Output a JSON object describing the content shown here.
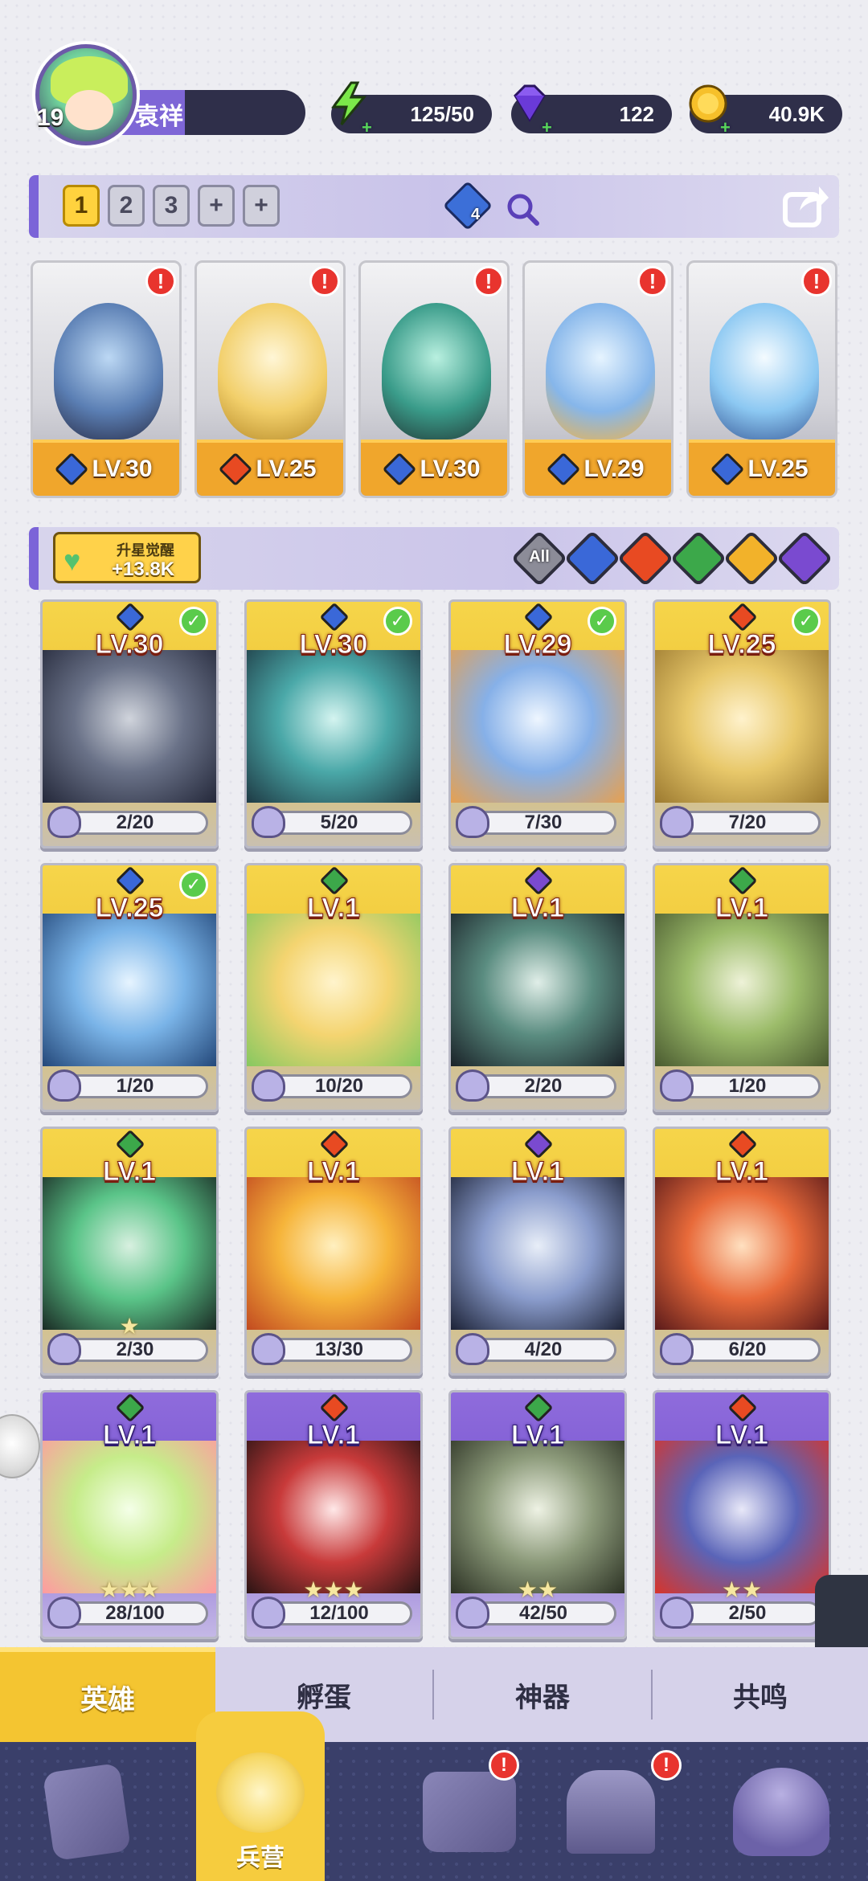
{
  "player": {
    "level": "19",
    "name": "袁祥"
  },
  "resources": {
    "energy": {
      "value": "125/50",
      "icon": "lightning-icon"
    },
    "gems": {
      "value": "122",
      "icon": "gem-icon"
    },
    "gold": {
      "value": "40.9K",
      "icon": "coin-icon"
    }
  },
  "team": {
    "tabs": [
      "1",
      "2",
      "3",
      "+",
      "+"
    ],
    "active_tab": "1",
    "element_count": "4",
    "alert_glyph": "!",
    "lineup": [
      {
        "level": "LV.30",
        "element": "water",
        "color": "#3a68d8"
      },
      {
        "level": "LV.25",
        "element": "fire",
        "color": "#e84a22"
      },
      {
        "level": "LV.30",
        "element": "water",
        "color": "#3a68d8"
      },
      {
        "level": "LV.29",
        "element": "water",
        "color": "#3a68d8"
      },
      {
        "level": "LV.25",
        "element": "water",
        "color": "#3a68d8"
      }
    ]
  },
  "awaken": {
    "label": "升星觉醒",
    "value": "+13.8K"
  },
  "filters": [
    {
      "label": "All",
      "color": "#8c8c98"
    },
    {
      "label": "",
      "color": "#3a68d8"
    },
    {
      "label": "",
      "color": "#e84a22"
    },
    {
      "label": "",
      "color": "#3ca84a"
    },
    {
      "label": "",
      "color": "#f2b22a"
    },
    {
      "label": "",
      "color": "#7a4ad0"
    }
  ],
  "heroes": [
    {
      "level": "LV.30",
      "progress": "2/20",
      "element": "water",
      "checked": true,
      "frame": "gold",
      "stars": ""
    },
    {
      "level": "LV.30",
      "progress": "5/20",
      "element": "water",
      "checked": true,
      "frame": "gold",
      "stars": ""
    },
    {
      "level": "LV.29",
      "progress": "7/30",
      "element": "water",
      "checked": true,
      "frame": "gold",
      "stars": ""
    },
    {
      "level": "LV.25",
      "progress": "7/20",
      "element": "fire",
      "checked": true,
      "frame": "gold",
      "stars": ""
    },
    {
      "level": "LV.25",
      "progress": "1/20",
      "element": "water",
      "checked": true,
      "frame": "gold",
      "stars": ""
    },
    {
      "level": "LV.1",
      "progress": "10/20",
      "element": "earth",
      "checked": false,
      "frame": "gold",
      "stars": ""
    },
    {
      "level": "LV.1",
      "progress": "2/20",
      "element": "dark",
      "checked": false,
      "frame": "gold",
      "stars": ""
    },
    {
      "level": "LV.1",
      "progress": "1/20",
      "element": "earth",
      "checked": false,
      "frame": "gold",
      "stars": ""
    },
    {
      "level": "LV.1",
      "progress": "2/30",
      "element": "earth",
      "checked": false,
      "frame": "gold",
      "stars": "★"
    },
    {
      "level": "LV.1",
      "progress": "13/30",
      "element": "fire",
      "checked": false,
      "frame": "gold",
      "stars": ""
    },
    {
      "level": "LV.1",
      "progress": "4/20",
      "element": "dark",
      "checked": false,
      "frame": "gold",
      "stars": ""
    },
    {
      "level": "LV.1",
      "progress": "6/20",
      "element": "fire",
      "checked": false,
      "frame": "gold",
      "stars": ""
    },
    {
      "level": "LV.1",
      "progress": "28/100",
      "element": "earth",
      "checked": false,
      "frame": "purple",
      "stars": "★★★"
    },
    {
      "level": "LV.1",
      "progress": "12/100",
      "element": "fire",
      "checked": false,
      "frame": "purple",
      "stars": "★★★"
    },
    {
      "level": "LV.1",
      "progress": "42/50",
      "element": "earth",
      "checked": false,
      "frame": "purple",
      "stars": "★★"
    },
    {
      "level": "LV.1",
      "progress": "2/50",
      "element": "fire",
      "checked": false,
      "frame": "purple",
      "stars": "★★"
    }
  ],
  "element_colors": {
    "water": "#3a68d8",
    "fire": "#e84a22",
    "earth": "#3ca84a",
    "dark": "#7a4ad0"
  },
  "subtabs": [
    "英雄",
    "孵蛋",
    "神器",
    "共鸣"
  ],
  "active_subtab": "英雄",
  "nav": [
    {
      "icon": "cards-icon",
      "label": ""
    },
    {
      "icon": "barracks-icon",
      "label": "兵营"
    },
    {
      "icon": "map-icon",
      "label": ""
    },
    {
      "icon": "temple-icon",
      "label": ""
    },
    {
      "icon": "mushroom-icon",
      "label": ""
    }
  ],
  "side_collapse_glyph": "‹"
}
